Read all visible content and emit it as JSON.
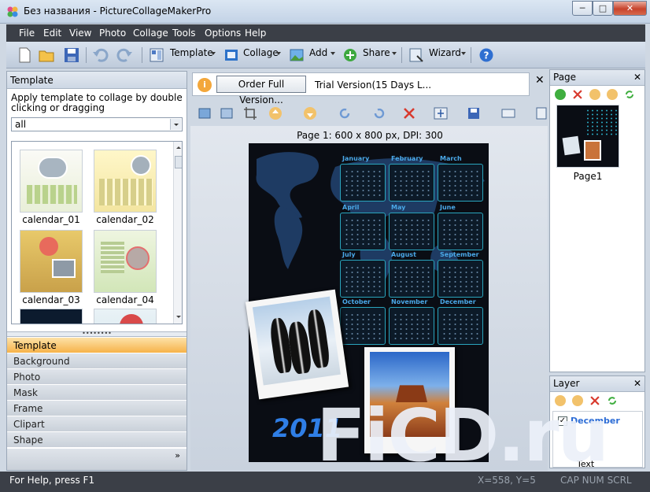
{
  "window": {
    "title": "Без названия - PictureCollageMakerPro",
    "min": "─",
    "max": "□",
    "close": "✕"
  },
  "menu": [
    "File",
    "Edit",
    "View",
    "Photo",
    "Collage",
    "Tools",
    "Options",
    "Help"
  ],
  "toolbar": {
    "template": "Template",
    "collage": "Collage",
    "add": "Add",
    "share": "Share",
    "wizard": "Wizard"
  },
  "left": {
    "header": "Template",
    "hint": "Apply template to collage by double clicking or dragging",
    "filter": "all",
    "thumbs": [
      "calendar_01",
      "calendar_02",
      "calendar_03",
      "calendar_04"
    ],
    "split_grip": "••••••••",
    "accordion": [
      "Template",
      "Background",
      "Photo",
      "Mask",
      "Frame",
      "Clipart",
      "Shape"
    ],
    "more": "»"
  },
  "order": {
    "icon": "i",
    "button": "Order Full Version...",
    "text": "Trial Version(15 Days L..."
  },
  "center_close": "✕",
  "page_info": "Page 1: 600 x 800 px, DPI: 300",
  "calendar": {
    "months": [
      "January",
      "February",
      "March",
      "April",
      "May",
      "June",
      "July",
      "August",
      "September",
      "October",
      "November",
      "December"
    ],
    "year": "2011"
  },
  "page_panel": {
    "title": "Page",
    "close": "✕",
    "page_label": "Page1"
  },
  "layer_panel": {
    "title": "Layer",
    "close": "✕",
    "layer_name": "December",
    "layer_text": "Text",
    "check": "✓"
  },
  "status": {
    "help": "For Help, press F1",
    "coords": "X=558, Y=5",
    "indicators": "CAP NUM SCRL"
  },
  "watermark": "FiCD.ru"
}
